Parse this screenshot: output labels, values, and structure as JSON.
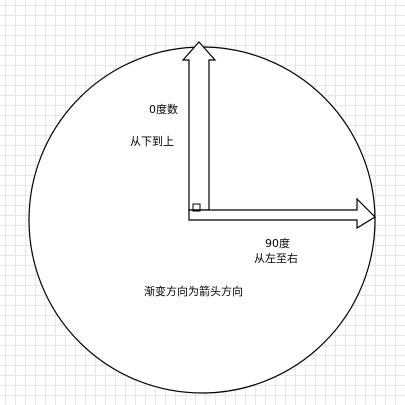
{
  "labels": {
    "zero_degree": "0度数",
    "bottom_to_top": "从下到上",
    "ninety_degree": "90度",
    "left_to_right": "从左至右",
    "gradient_direction": "渐变方向为箭头方向"
  },
  "colors": {
    "stroke": "#000000",
    "fill": "#ffffff",
    "grid": "#e6e6e6"
  }
}
